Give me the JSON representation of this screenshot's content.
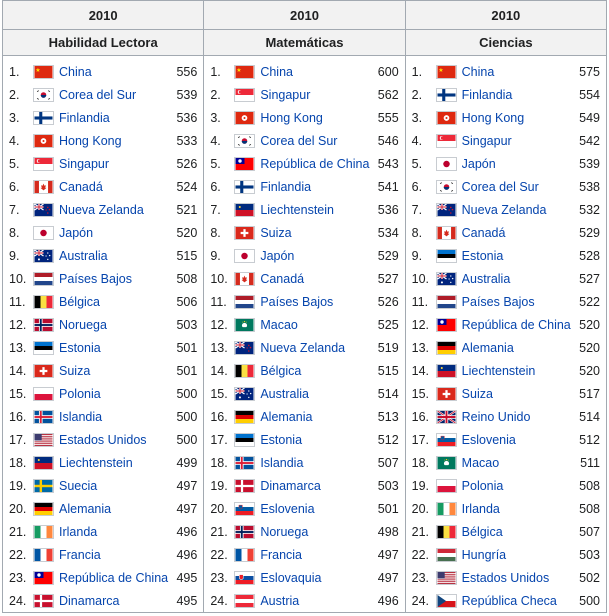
{
  "columns": [
    {
      "year": "2010",
      "subject": "Habilidad Lectora",
      "rows": [
        {
          "rank": "1.",
          "country": "China",
          "score": "556",
          "flag": "cn"
        },
        {
          "rank": "2.",
          "country": "Corea del Sur",
          "score": "539",
          "flag": "kr"
        },
        {
          "rank": "3.",
          "country": "Finlandia",
          "score": "536",
          "flag": "fi"
        },
        {
          "rank": "4.",
          "country": "Hong Kong",
          "score": "533",
          "flag": "hk"
        },
        {
          "rank": "5.",
          "country": "Singapur",
          "score": "526",
          "flag": "sg"
        },
        {
          "rank": "6.",
          "country": "Canadá",
          "score": "524",
          "flag": "ca"
        },
        {
          "rank": "7.",
          "country": "Nueva Zelanda",
          "score": "521",
          "flag": "nz"
        },
        {
          "rank": "8.",
          "country": "Japón",
          "score": "520",
          "flag": "jp"
        },
        {
          "rank": "9.",
          "country": "Australia",
          "score": "515",
          "flag": "au"
        },
        {
          "rank": "10.",
          "country": "Países Bajos",
          "score": "508",
          "flag": "nl"
        },
        {
          "rank": "11.",
          "country": "Bélgica",
          "score": "506",
          "flag": "be"
        },
        {
          "rank": "12.",
          "country": "Noruega",
          "score": "503",
          "flag": "no"
        },
        {
          "rank": "13.",
          "country": "Estonia",
          "score": "501",
          "flag": "ee"
        },
        {
          "rank": "14.",
          "country": "Suiza",
          "score": "501",
          "flag": "ch"
        },
        {
          "rank": "15.",
          "country": "Polonia",
          "score": "500",
          "flag": "pl"
        },
        {
          "rank": "16.",
          "country": "Islandia",
          "score": "500",
          "flag": "is"
        },
        {
          "rank": "17.",
          "country": "Estados Unidos",
          "score": "500",
          "flag": "us"
        },
        {
          "rank": "18.",
          "country": "Liechtenstein",
          "score": "499",
          "flag": "li"
        },
        {
          "rank": "19.",
          "country": "Suecia",
          "score": "497",
          "flag": "se"
        },
        {
          "rank": "20.",
          "country": "Alemania",
          "score": "497",
          "flag": "de"
        },
        {
          "rank": "21.",
          "country": "Irlanda",
          "score": "496",
          "flag": "ie"
        },
        {
          "rank": "22.",
          "country": "Francia",
          "score": "496",
          "flag": "fr"
        },
        {
          "rank": "23.",
          "country": "República de China",
          "score": "495",
          "flag": "tw"
        },
        {
          "rank": "24.",
          "country": "Dinamarca",
          "score": "495",
          "flag": "dk"
        }
      ]
    },
    {
      "year": "2010",
      "subject": "Matemáticas",
      "rows": [
        {
          "rank": "1.",
          "country": "China",
          "score": "600",
          "flag": "cn"
        },
        {
          "rank": "2.",
          "country": "Singapur",
          "score": "562",
          "flag": "sg"
        },
        {
          "rank": "3.",
          "country": "Hong Kong",
          "score": "555",
          "flag": "hk"
        },
        {
          "rank": "4.",
          "country": "Corea del Sur",
          "score": "546",
          "flag": "kr"
        },
        {
          "rank": "5.",
          "country": "República de China",
          "score": "543",
          "flag": "tw"
        },
        {
          "rank": "6.",
          "country": "Finlandia",
          "score": "541",
          "flag": "fi"
        },
        {
          "rank": "7.",
          "country": "Liechtenstein",
          "score": "536",
          "flag": "li"
        },
        {
          "rank": "8.",
          "country": "Suiza",
          "score": "534",
          "flag": "ch"
        },
        {
          "rank": "9.",
          "country": "Japón",
          "score": "529",
          "flag": "jp"
        },
        {
          "rank": "10.",
          "country": "Canadá",
          "score": "527",
          "flag": "ca"
        },
        {
          "rank": "11.",
          "country": "Países Bajos",
          "score": "526",
          "flag": "nl"
        },
        {
          "rank": "12.",
          "country": "Macao",
          "score": "525",
          "flag": "mo"
        },
        {
          "rank": "13.",
          "country": "Nueva Zelanda",
          "score": "519",
          "flag": "nz"
        },
        {
          "rank": "14.",
          "country": "Bélgica",
          "score": "515",
          "flag": "be"
        },
        {
          "rank": "15.",
          "country": "Australia",
          "score": "514",
          "flag": "au"
        },
        {
          "rank": "16.",
          "country": "Alemania",
          "score": "513",
          "flag": "de"
        },
        {
          "rank": "17.",
          "country": "Estonia",
          "score": "512",
          "flag": "ee"
        },
        {
          "rank": "18.",
          "country": "Islandia",
          "score": "507",
          "flag": "is"
        },
        {
          "rank": "19.",
          "country": "Dinamarca",
          "score": "503",
          "flag": "dk"
        },
        {
          "rank": "20.",
          "country": "Eslovenia",
          "score": "501",
          "flag": "si"
        },
        {
          "rank": "21.",
          "country": "Noruega",
          "score": "498",
          "flag": "no"
        },
        {
          "rank": "22.",
          "country": "Francia",
          "score": "497",
          "flag": "fr"
        },
        {
          "rank": "23.",
          "country": "Eslovaquia",
          "score": "497",
          "flag": "sk"
        },
        {
          "rank": "24.",
          "country": "Austria",
          "score": "496",
          "flag": "at"
        }
      ]
    },
    {
      "year": "2010",
      "subject": "Ciencias",
      "rows": [
        {
          "rank": "1.",
          "country": "China",
          "score": "575",
          "flag": "cn"
        },
        {
          "rank": "2.",
          "country": "Finlandia",
          "score": "554",
          "flag": "fi"
        },
        {
          "rank": "3.",
          "country": "Hong Kong",
          "score": "549",
          "flag": "hk"
        },
        {
          "rank": "4.",
          "country": "Singapur",
          "score": "542",
          "flag": "sg"
        },
        {
          "rank": "5.",
          "country": "Japón",
          "score": "539",
          "flag": "jp"
        },
        {
          "rank": "6.",
          "country": "Corea del Sur",
          "score": "538",
          "flag": "kr"
        },
        {
          "rank": "7.",
          "country": "Nueva Zelanda",
          "score": "532",
          "flag": "nz"
        },
        {
          "rank": "8.",
          "country": "Canadá",
          "score": "529",
          "flag": "ca"
        },
        {
          "rank": "9.",
          "country": "Estonia",
          "score": "528",
          "flag": "ee"
        },
        {
          "rank": "10.",
          "country": "Australia",
          "score": "527",
          "flag": "au"
        },
        {
          "rank": "11.",
          "country": "Países Bajos",
          "score": "522",
          "flag": "nl"
        },
        {
          "rank": "12.",
          "country": "República de China",
          "score": "520",
          "flag": "tw"
        },
        {
          "rank": "13.",
          "country": "Alemania",
          "score": "520",
          "flag": "de"
        },
        {
          "rank": "14.",
          "country": "Liechtenstein",
          "score": "520",
          "flag": "li"
        },
        {
          "rank": "15.",
          "country": "Suiza",
          "score": "517",
          "flag": "ch"
        },
        {
          "rank": "16.",
          "country": "Reino Unido",
          "score": "514",
          "flag": "gb"
        },
        {
          "rank": "17.",
          "country": "Eslovenia",
          "score": "512",
          "flag": "si"
        },
        {
          "rank": "18.",
          "country": "Macao",
          "score": "511",
          "flag": "mo"
        },
        {
          "rank": "19.",
          "country": "Polonia",
          "score": "508",
          "flag": "pl"
        },
        {
          "rank": "20.",
          "country": "Irlanda",
          "score": "508",
          "flag": "ie"
        },
        {
          "rank": "21.",
          "country": "Bélgica",
          "score": "507",
          "flag": "be"
        },
        {
          "rank": "22.",
          "country": "Hungría",
          "score": "503",
          "flag": "hu"
        },
        {
          "rank": "23.",
          "country": "Estados Unidos",
          "score": "502",
          "flag": "us"
        },
        {
          "rank": "24.",
          "country": "República Checa",
          "score": "500",
          "flag": "cz"
        }
      ]
    }
  ]
}
